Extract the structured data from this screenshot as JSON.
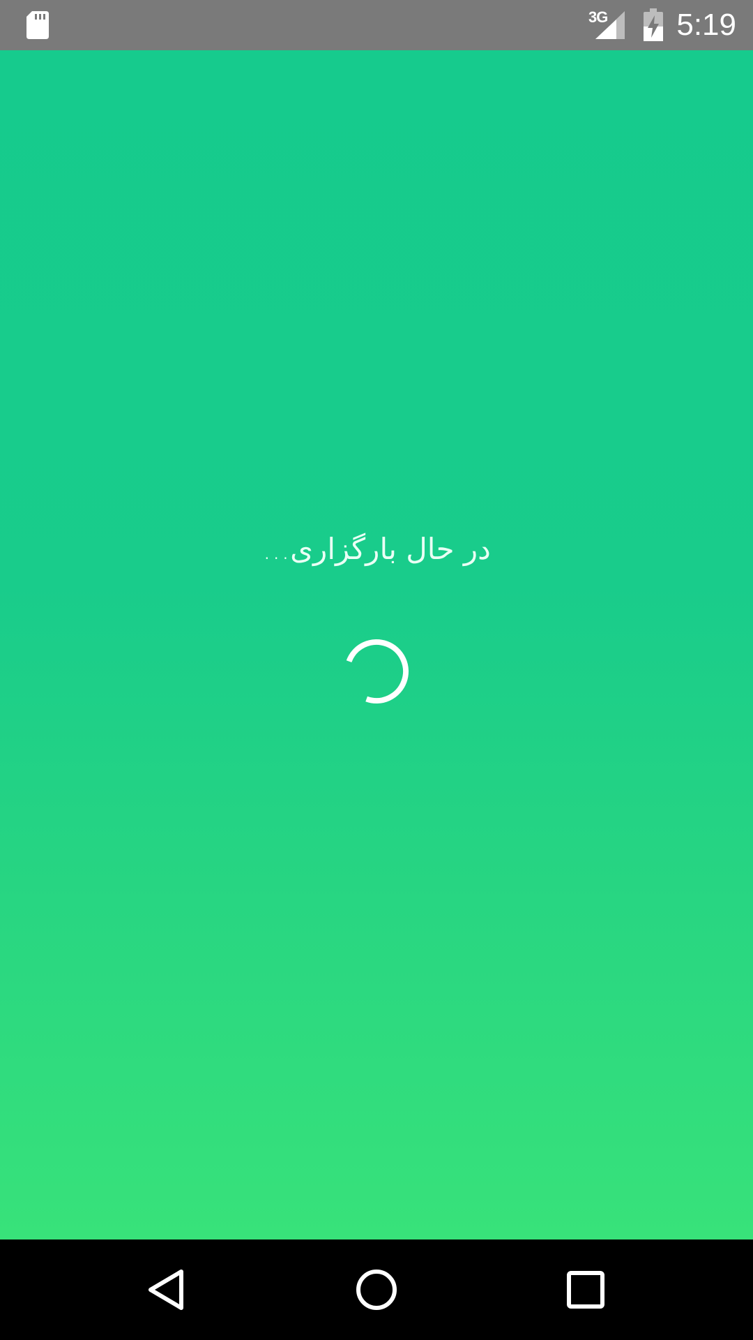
{
  "status_bar": {
    "network_type": "3G",
    "time": "5:19",
    "icons": [
      "sd-card-icon",
      "signal-icon",
      "battery-charging-icon"
    ],
    "color": "#7a7a7a"
  },
  "main": {
    "loading_text": "در حال بارگزاری...",
    "spinner_icon": "loading-spinner-icon",
    "gradient_top": "#16cb8d",
    "gradient_bottom": "#38e27a"
  },
  "nav_bar": {
    "buttons": [
      "back-icon",
      "home-icon",
      "recents-icon"
    ],
    "color": "#000000"
  }
}
